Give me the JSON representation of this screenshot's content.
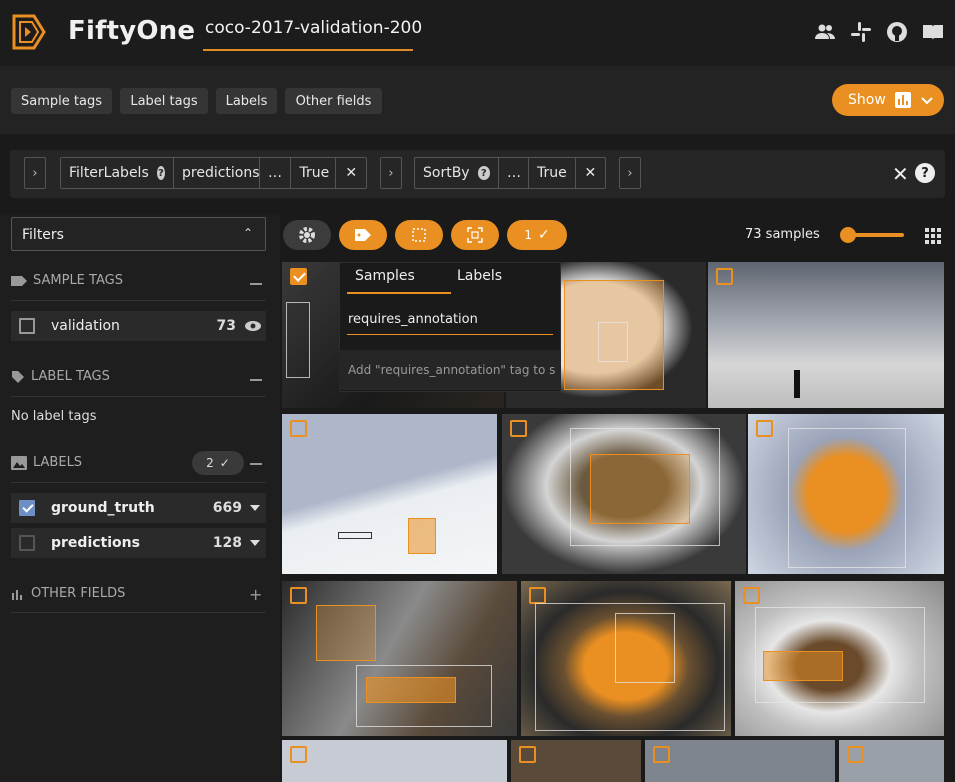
{
  "header": {
    "brand": "FiftyOne",
    "dataset": "coco-2017-validation-200",
    "icons": [
      "users-icon",
      "slack-icon",
      "github-icon",
      "book-icon"
    ]
  },
  "toolbar": {
    "tabs": [
      "Sample tags",
      "Label tags",
      "Labels",
      "Other fields"
    ],
    "show_label": "Show"
  },
  "view_bar": {
    "stages": [
      {
        "name": "FilterLabels",
        "params": [
          "predictions",
          "…",
          "True"
        ]
      },
      {
        "name": "SortBy",
        "params": [
          "…",
          "True"
        ]
      }
    ],
    "close_label": "✕",
    "help_label": "?"
  },
  "sidebar": {
    "filters_label": "Filters",
    "sample_tags": {
      "title": "SAMPLE TAGS",
      "items": [
        {
          "name": "validation",
          "count": "73"
        }
      ]
    },
    "label_tags": {
      "title": "LABEL TAGS",
      "empty": "No label tags"
    },
    "labels": {
      "title": "LABELS",
      "badge": "2",
      "items": [
        {
          "name": "ground_truth",
          "count": "669",
          "checked": true
        },
        {
          "name": "predictions",
          "count": "128",
          "checked": false
        }
      ]
    },
    "other_fields": {
      "title": "OTHER FIELDS"
    }
  },
  "main": {
    "selected_count": "1",
    "samples_label": "73 samples",
    "popup": {
      "tab_samples": "Samples",
      "tab_labels": "Labels",
      "input_value": "requires_annotation",
      "add_hint": "Add \"requires_annotation\" tag to s"
    }
  },
  "colors": {
    "accent": "#ea8f21",
    "label_check": "#6d8fc4"
  }
}
